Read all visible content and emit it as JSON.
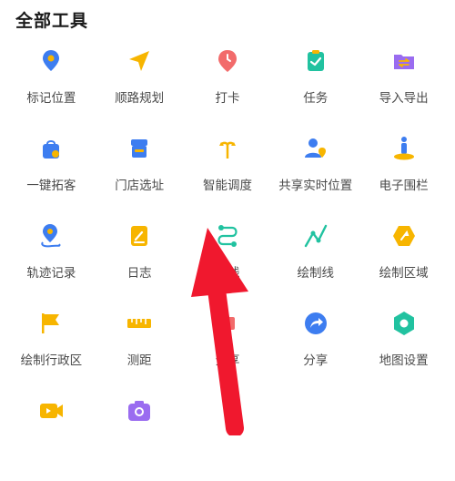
{
  "header": {
    "title": "全部工具"
  },
  "tools": [
    {
      "label": "标记位置",
      "icon": "location-pin-icon"
    },
    {
      "label": "顺路规划",
      "icon": "navigation-arrow-icon"
    },
    {
      "label": "打卡",
      "icon": "clock-pin-icon"
    },
    {
      "label": "任务",
      "icon": "task-clipboard-icon"
    },
    {
      "label": "导入导出",
      "icon": "import-export-folder-icon"
    },
    {
      "label": "一键拓客",
      "icon": "shopping-bag-icon"
    },
    {
      "label": "门店选址",
      "icon": "store-icon"
    },
    {
      "label": "智能调度",
      "icon": "dispatch-arrows-icon"
    },
    {
      "label": "共享实时位置",
      "icon": "share-location-user-icon"
    },
    {
      "label": "电子围栏",
      "icon": "geofence-person-icon"
    },
    {
      "label": "轨迹记录",
      "icon": "track-pin-icon"
    },
    {
      "label": "日志",
      "icon": "log-book-icon"
    },
    {
      "label": "路线",
      "icon": "route-icon"
    },
    {
      "label": "绘制线",
      "icon": "draw-line-icon"
    },
    {
      "label": "绘制区域",
      "icon": "draw-area-icon"
    },
    {
      "label": "绘制行政区",
      "icon": "flag-icon"
    },
    {
      "label": "测距",
      "icon": "ruler-icon"
    },
    {
      "label": "分享",
      "icon": "share-icon"
    },
    {
      "label": "分享",
      "icon": "share-arrow-icon"
    },
    {
      "label": "地图设置",
      "icon": "map-settings-icon"
    },
    {
      "label": "",
      "icon": "video-camera-icon"
    },
    {
      "label": "",
      "icon": "camera-icon"
    }
  ],
  "colors": {
    "blue": "#3d7df0",
    "yellow": "#f7b500",
    "red": "#f26b6b",
    "green": "#21c2a0",
    "purple": "#9a6cf0",
    "arrow": "#f0182e"
  }
}
